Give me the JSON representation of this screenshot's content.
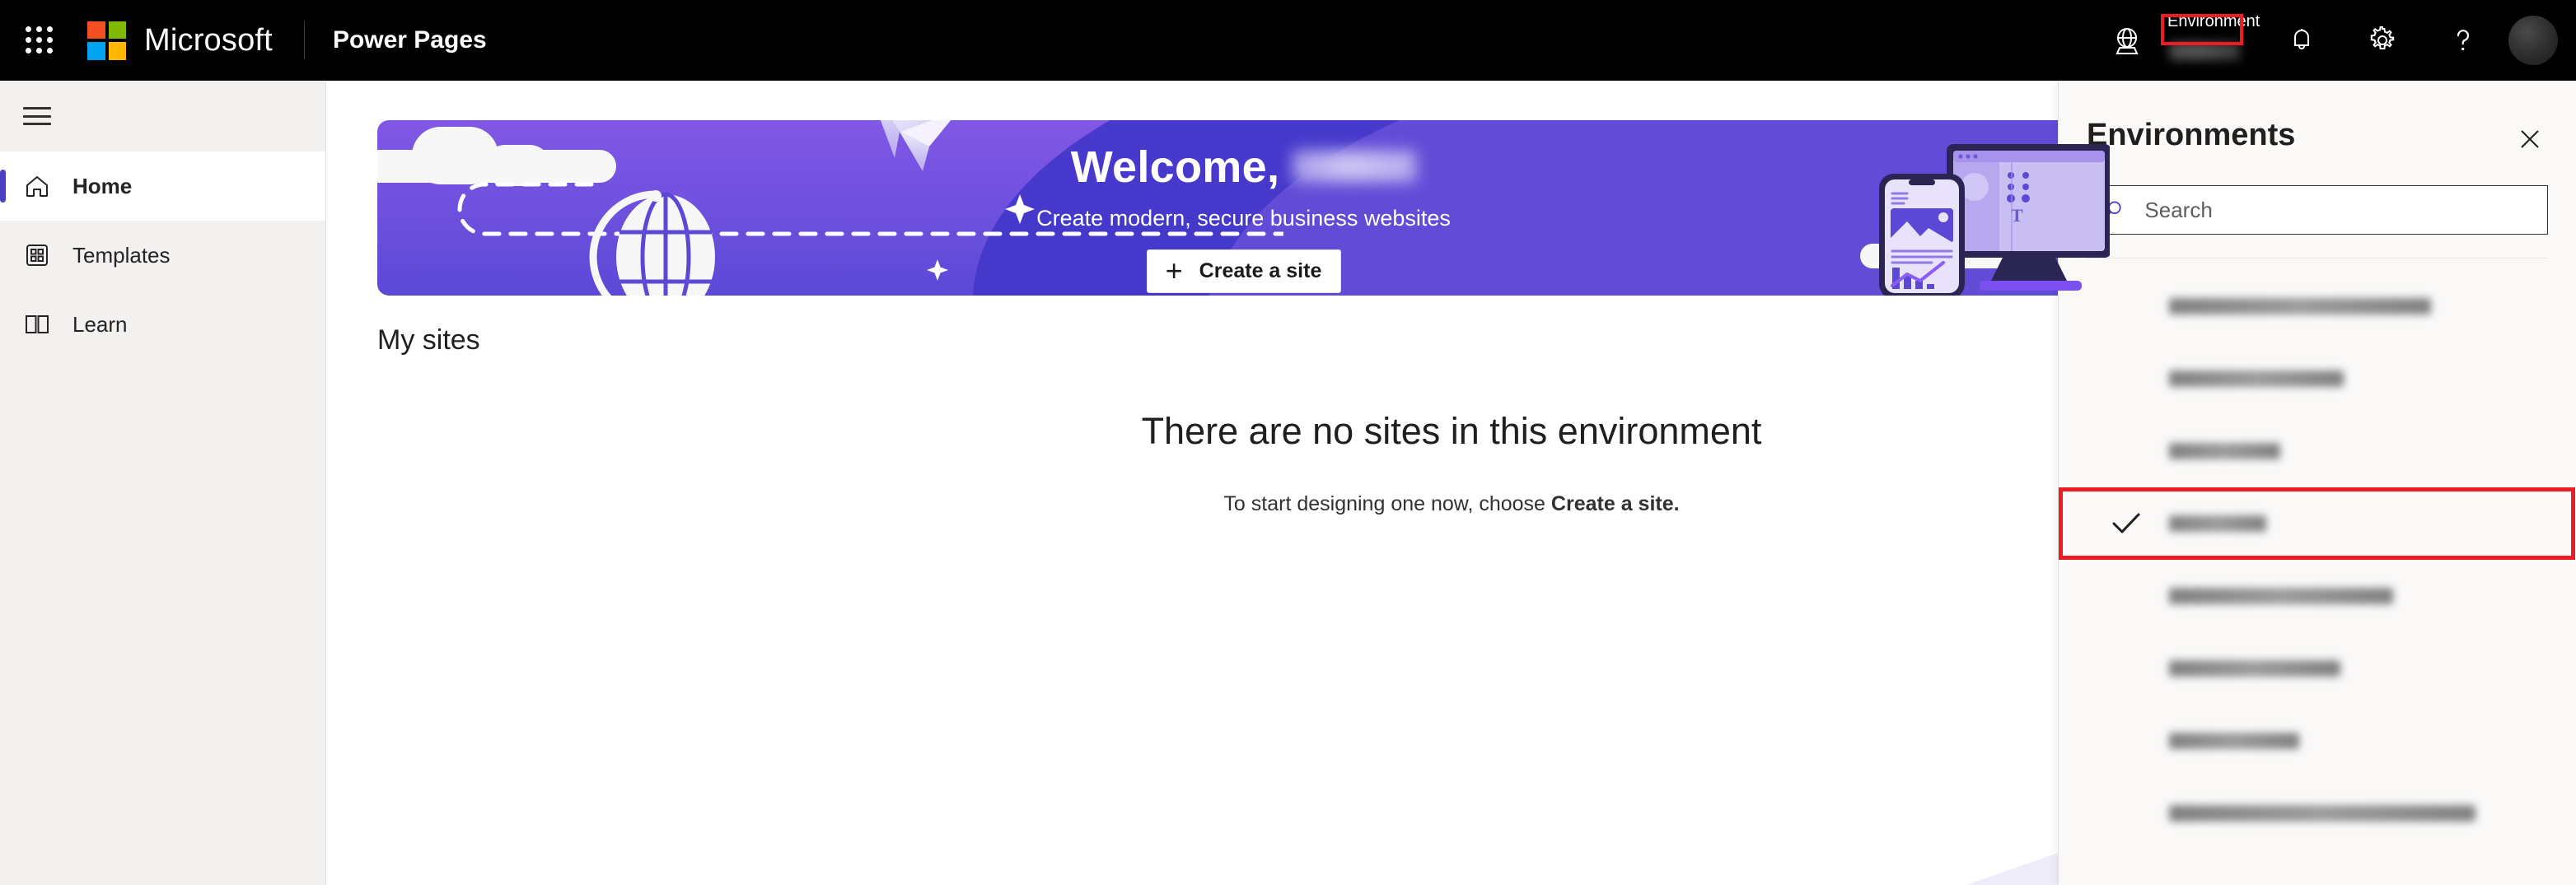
{
  "topbar": {
    "waffle_icon": "app-launcher-icon",
    "brand": "Microsoft",
    "app_name": "Power Pages",
    "environment_label": "Environment",
    "environment_value": "",
    "globe_icon": "environment-globe-icon",
    "notifications_icon": "bell-icon",
    "settings_icon": "gear-icon",
    "help_icon": "question-mark-icon",
    "avatar_icon": "user-avatar",
    "highlight_color": "#ee1c25",
    "background": "#000000"
  },
  "sidebar": {
    "menu_icon": "hamburger-icon",
    "items": [
      {
        "label": "Home",
        "icon": "home-icon",
        "active": true
      },
      {
        "label": "Templates",
        "icon": "templates-grid-icon",
        "active": false
      },
      {
        "label": "Learn",
        "icon": "book-icon",
        "active": false
      }
    ],
    "accent_color": "#4b3ec4",
    "background": "#f2f1f0"
  },
  "banner": {
    "welcome_prefix": "Welcome,",
    "welcome_user": "",
    "subtitle": "Create modern, secure business websites",
    "create_button": "Create a site",
    "plus_icon": "plus-icon",
    "art": {
      "globe": "globe-on-stand-illustration",
      "paper_plane": "paper-plane-illustration",
      "clouds": "cloud-illustration",
      "devices": "monitor-and-phone-illustration",
      "sparkle": "sparkle-icon"
    },
    "gradient_from": "#8257e5",
    "gradient_to": "#5b49d6"
  },
  "main": {
    "section_title": "My sites",
    "empty_title": "There are no sites in this environment",
    "empty_sub_before": "To start designing one now, choose ",
    "empty_sub_strong": "Create a site.",
    "corner_shape_color": "#efecfa"
  },
  "env_panel": {
    "title": "Environments",
    "close_icon": "close-icon",
    "search": {
      "icon": "search-icon",
      "placeholder": "Search",
      "value": ""
    },
    "check_icon": "checkmark-icon",
    "highlight_color": "#ee1c25",
    "background": "#faf9f8",
    "items": [
      {
        "name": "",
        "selected": false,
        "blur_width": 318
      },
      {
        "name": "",
        "selected": false,
        "blur_width": 212
      },
      {
        "name": "",
        "selected": false,
        "blur_width": 135
      },
      {
        "name": "",
        "selected": true,
        "blur_width": 118
      },
      {
        "name": "",
        "selected": false,
        "blur_width": 272
      },
      {
        "name": "",
        "selected": false,
        "blur_width": 208
      },
      {
        "name": "",
        "selected": false,
        "blur_width": 158
      },
      {
        "name": "",
        "selected": false,
        "blur_width": 372
      }
    ]
  }
}
